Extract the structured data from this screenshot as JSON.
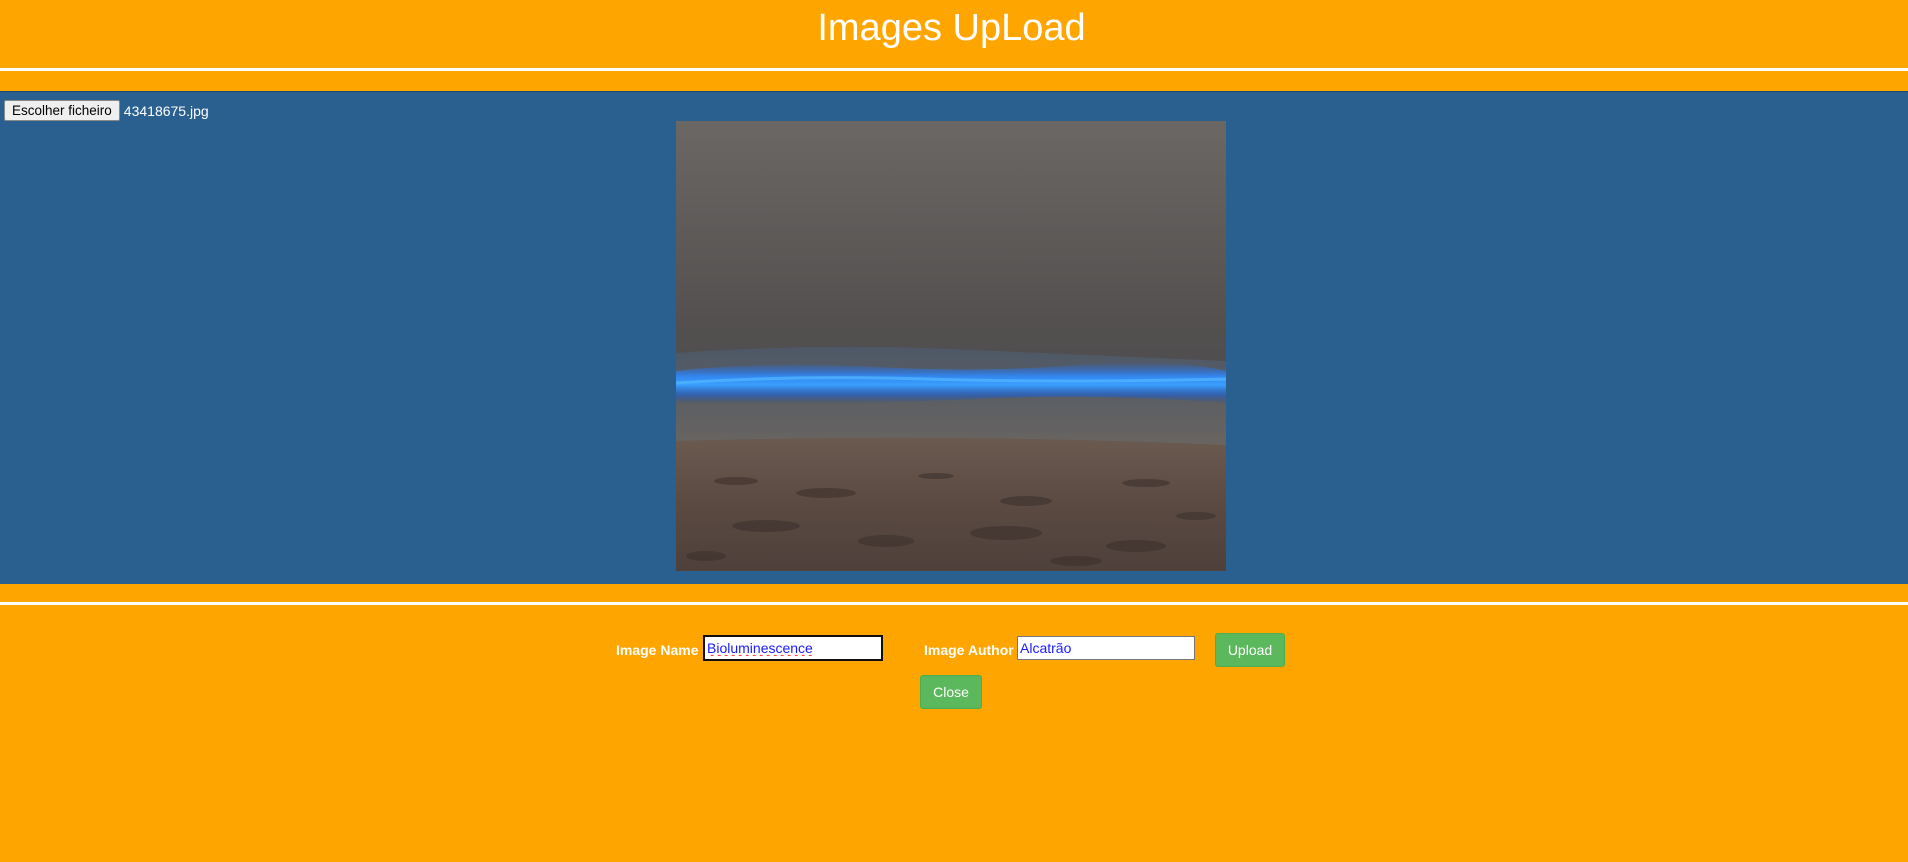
{
  "page": {
    "title": "Images UpLoad",
    "background_color": "#ffa500",
    "panel_color": "#2a608f",
    "button_color": "#5cb85c"
  },
  "file_picker": {
    "button_label": "Escolher ficheiro",
    "selected_file": "43418675.jpg"
  },
  "preview": {
    "description_icon": "image-preview"
  },
  "form": {
    "image_name_label": "Image Name",
    "image_name_value": "Bioluminescence",
    "image_author_label": "Image Author",
    "image_author_value": "Alcatrão",
    "upload_label": "Upload",
    "close_label": "Close"
  }
}
